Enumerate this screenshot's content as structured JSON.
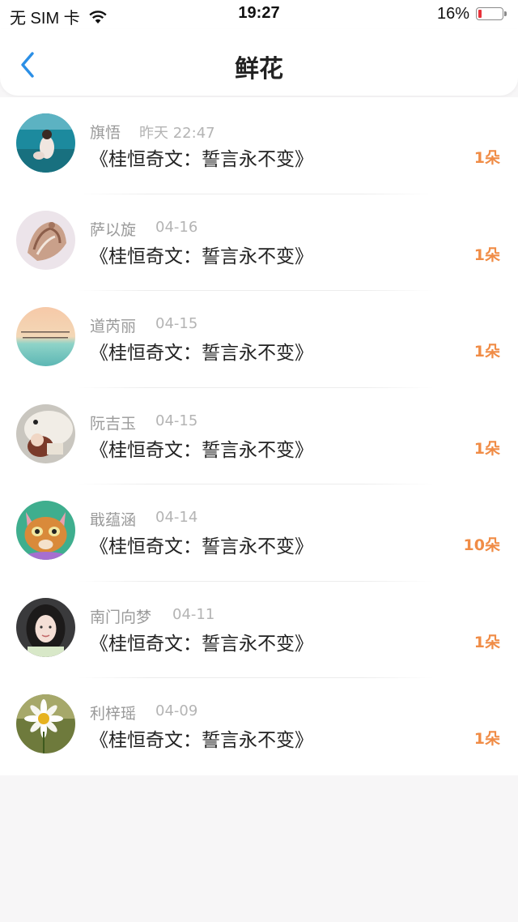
{
  "status_bar": {
    "carrier": "无 SIM 卡",
    "time": "19:27",
    "battery": "16%",
    "battery_level": 0.16,
    "wifi_icon": "wifi-icon",
    "battery_icon": "battery-icon"
  },
  "nav": {
    "title": "鲜花",
    "back_icon": "chevron-left-icon",
    "back_color": "#2b8fe6"
  },
  "accent_color": "#f08c46",
  "items": [
    {
      "name": "旗悟",
      "date": "昨天 22:47",
      "title": "《桂恒奇文：誓言永不变》",
      "count": "1朵",
      "avatar": "avatar-ocean-couple"
    },
    {
      "name": "萨以旋",
      "date": "04-16",
      "title": "《桂恒奇文：誓言永不变》",
      "count": "1朵",
      "avatar": "avatar-seashell"
    },
    {
      "name": "道芮丽",
      "date": "04-15",
      "title": "《桂恒奇文：誓言永不变》",
      "count": "1朵",
      "avatar": "avatar-sunset-sea"
    },
    {
      "name": "阮吉玉",
      "date": "04-15",
      "title": "《桂恒奇文：誓言永不变》",
      "count": "1朵",
      "avatar": "avatar-girl-polar-bear"
    },
    {
      "name": "戢蕴涵",
      "date": "04-14",
      "title": "《桂恒奇文：誓言永不变》",
      "count": "10朵",
      "avatar": "avatar-cartoon-cat"
    },
    {
      "name": "南门向梦",
      "date": "04-11",
      "title": "《桂恒奇文：誓言永不变》",
      "count": "1朵",
      "avatar": "avatar-girl-portrait"
    },
    {
      "name": "利梓瑶",
      "date": "04-09",
      "title": "《桂恒奇文：誓言永不变》",
      "count": "1朵",
      "avatar": "avatar-daisy"
    }
  ]
}
